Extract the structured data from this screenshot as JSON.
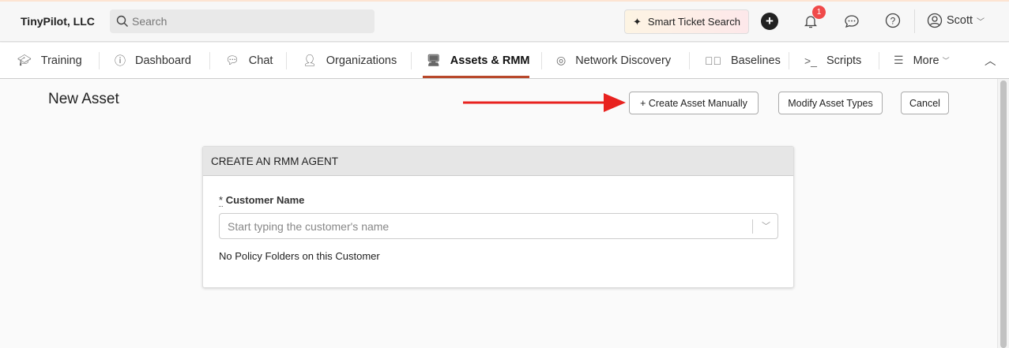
{
  "header": {
    "org": "TinyPilot, LLC",
    "search_placeholder": "Search",
    "smart_search": "Smart Ticket Search",
    "notification_count": "1",
    "user": "Scott"
  },
  "nav": {
    "tabs": [
      {
        "label": "Training",
        "icon": "graduation-cap-icon"
      },
      {
        "label": "Dashboard",
        "icon": "gauge-icon"
      },
      {
        "label": "Chat",
        "icon": "chat-icon"
      },
      {
        "label": "Organizations",
        "icon": "user-icon"
      },
      {
        "label": "Assets & RMM",
        "icon": "monitor-icon",
        "active": true
      },
      {
        "label": "Network Discovery",
        "icon": "radar-icon"
      },
      {
        "label": "Baselines",
        "icon": "badge-check-icon"
      },
      {
        "label": "Scripts",
        "icon": "terminal-icon"
      },
      {
        "label": "More",
        "icon": "menu-icon"
      }
    ]
  },
  "page": {
    "title": "New Asset",
    "create_manual": "+ Create Asset Manually",
    "modify_types": "Modify Asset Types",
    "cancel": "Cancel"
  },
  "card": {
    "title": "CREATE AN RMM AGENT",
    "required_mark": "*",
    "customer_label": "Customer Name",
    "customer_placeholder": "Start typing the customer's name",
    "policy_note": "No Policy Folders on this Customer"
  },
  "colors": {
    "accent": "#b8482b",
    "arrow": "#e8221f",
    "badge": "#f04a4a"
  }
}
